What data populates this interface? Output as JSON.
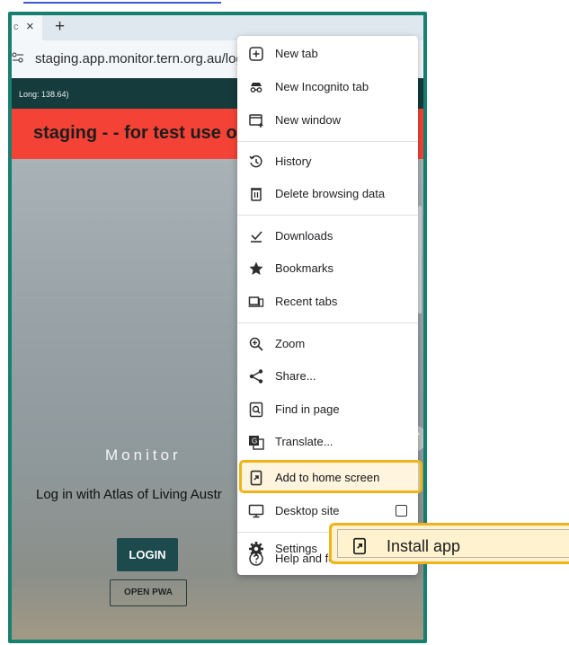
{
  "browser": {
    "tab_close": "×",
    "new_tab_glyph": "+",
    "url": "staging.app.monitor.tern.org.au/login"
  },
  "page": {
    "coords_text": "Long: 138.64)",
    "staging_banner": "staging - - for test use only",
    "app_title": "Monitor",
    "login_prompt": "Log in with Atlas of Living Austr",
    "login_button": "LOGIN",
    "open_pwa_button": "OPEN PWA"
  },
  "menu": {
    "items": [
      {
        "label": "New tab",
        "icon": "plus-box-icon"
      },
      {
        "label": "New Incognito tab",
        "icon": "incognito-icon"
      },
      {
        "label": "New window",
        "icon": "new-window-icon"
      },
      {
        "label": "History",
        "icon": "history-icon"
      },
      {
        "label": "Delete browsing data",
        "icon": "trash-icon"
      },
      {
        "label": "Downloads",
        "icon": "download-icon"
      },
      {
        "label": "Bookmarks",
        "icon": "star-icon"
      },
      {
        "label": "Recent tabs",
        "icon": "devices-icon"
      },
      {
        "label": "Zoom",
        "icon": "zoom-icon"
      },
      {
        "label": "Share...",
        "icon": "share-icon"
      },
      {
        "label": "Find in page",
        "icon": "find-icon"
      },
      {
        "label": "Translate...",
        "icon": "translate-icon"
      },
      {
        "label": "Add to home screen",
        "icon": "add-to-home-icon"
      },
      {
        "label": "Desktop site",
        "icon": "desktop-icon"
      },
      {
        "label": "Settings",
        "icon": "gear-icon"
      },
      {
        "label": "Help and feedback",
        "icon": "help-icon"
      }
    ]
  },
  "callout": {
    "label": "Install app",
    "icon": "install-app-icon"
  },
  "colors": {
    "frame": "#17806f",
    "banner": "#f44336",
    "highlight": "#f0b419",
    "header_dark": "#163b3c"
  }
}
